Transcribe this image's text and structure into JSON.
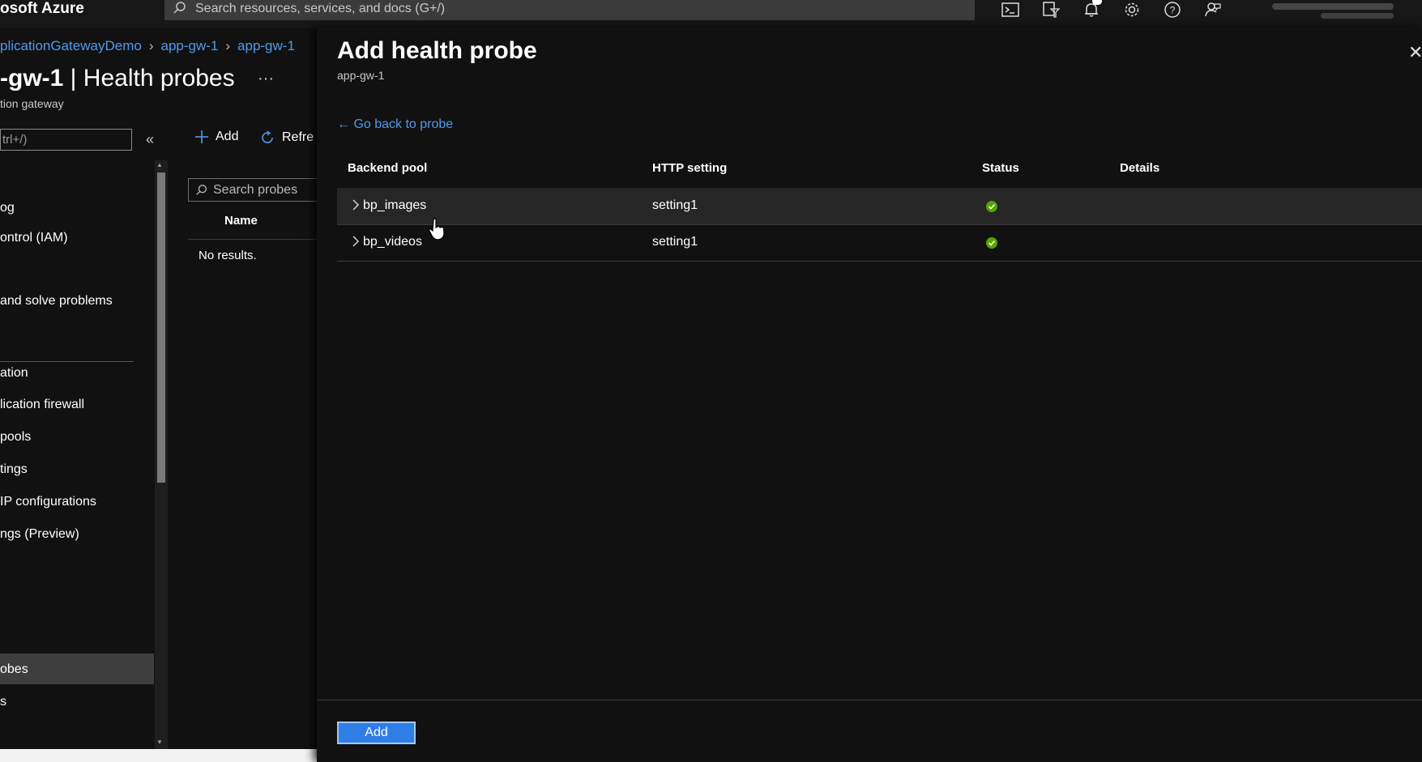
{
  "topbar": {
    "brand": "osoft Azure",
    "search_placeholder": "Search resources, services, and docs (G+/)",
    "icons": [
      "terminal-icon",
      "directory-filter-icon",
      "bell-icon",
      "gear-icon",
      "help-icon",
      "feedback-icon"
    ]
  },
  "breadcrumb": {
    "items": [
      "plicationGatewayDemo",
      "app-gw-1",
      "app-gw-1"
    ]
  },
  "page": {
    "title_bold": "-gw-1",
    "title_rest": " | Health probes",
    "subtitle": "tion gateway",
    "more": "···"
  },
  "sidebar": {
    "filter_placeholder": "trl+/)",
    "items": [
      {
        "label": "og"
      },
      {
        "label": "ontrol (IAM)"
      },
      {
        "label": " and solve problems"
      },
      {
        "label": "ation"
      },
      {
        "label": "lication firewall"
      },
      {
        "label": "pools"
      },
      {
        "label": "tings"
      },
      {
        "label": " IP configurations"
      },
      {
        "label": "ngs (Preview)"
      },
      {
        "label": "obes"
      },
      {
        "label": "s"
      }
    ]
  },
  "middle": {
    "add_label": "Add",
    "refresh_label": "Refre",
    "search_placeholder": "Search probes",
    "column_name": "Name",
    "empty": "No results."
  },
  "panel": {
    "title": "Add health probe",
    "subtitle": "app-gw-1",
    "back_link": "← Go back to probe",
    "columns": [
      "Backend pool",
      "HTTP setting",
      "Status",
      "Details"
    ],
    "rows": [
      {
        "pool": "bp_images",
        "setting": "setting1",
        "status": "healthy"
      },
      {
        "pool": "bp_videos",
        "setting": "setting1",
        "status": "healthy"
      }
    ],
    "add_button": "Add"
  },
  "colors": {
    "accent": "#4f9bea",
    "healthy": "#57a300",
    "button": "#2f7ee8"
  }
}
